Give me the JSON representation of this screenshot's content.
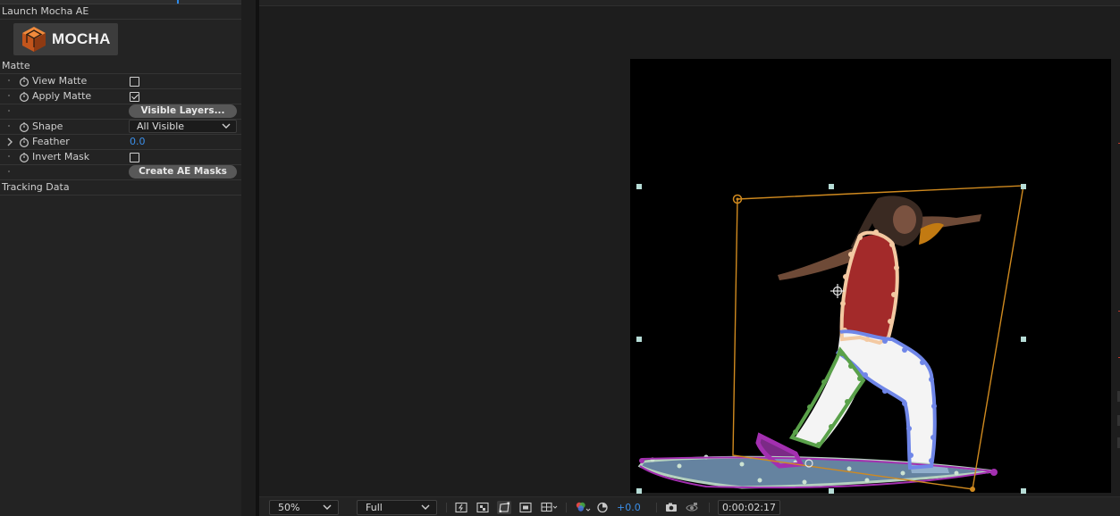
{
  "effect_controls": {
    "launch_label": "Launch Mocha AE",
    "logo_text": "MOCHA",
    "matte_section": "Matte",
    "rows": {
      "view_matte": "View Matte",
      "apply_matte": "Apply Matte",
      "shape": "Shape",
      "feather": "Feather",
      "invert_mask": "Invert Mask"
    },
    "view_matte_checked": false,
    "apply_matte_checked": true,
    "invert_mask_checked": false,
    "visible_layers_button": "Visible Layers...",
    "shape_value": "All Visible",
    "feather_value": "0.0",
    "create_masks_button": "Create AE Masks",
    "tracking_section": "Tracking Data"
  },
  "viewer": {
    "zoom": "50%",
    "resolution": "Full",
    "exposure": "+0.0",
    "timecode": "0:00:02:17"
  },
  "colors": {
    "accent": "#2d8ceb",
    "value_blue": "#3b8fe9",
    "track_orange": "#d08a1f",
    "spline_peach": "#f3c9a2",
    "spline_blue": "#6f86e8",
    "spline_green": "#5aa14a",
    "spline_purple": "#a32fb0",
    "spline_lightblue": "#8fb7d8"
  }
}
